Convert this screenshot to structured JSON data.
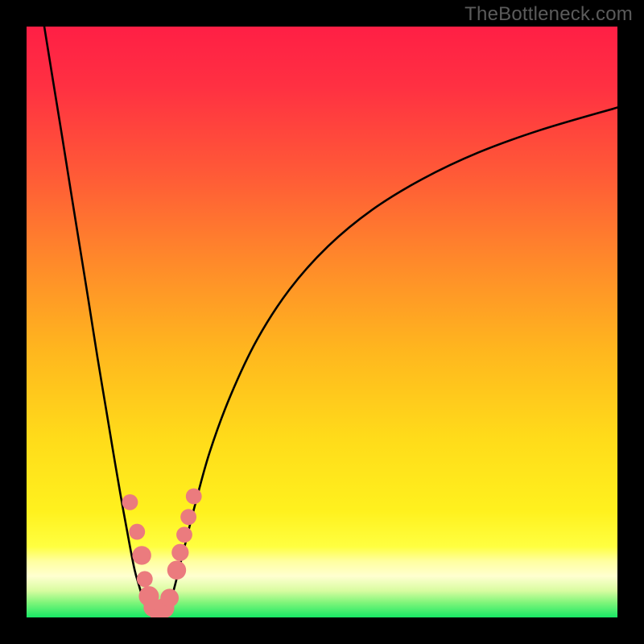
{
  "watermark": "TheBottleneck.com",
  "gradient_stops": [
    {
      "offset": 0.0,
      "color": "#ff1f45"
    },
    {
      "offset": 0.1,
      "color": "#ff3042"
    },
    {
      "offset": 0.25,
      "color": "#ff5a37"
    },
    {
      "offset": 0.4,
      "color": "#ff8a2a"
    },
    {
      "offset": 0.55,
      "color": "#ffb71e"
    },
    {
      "offset": 0.7,
      "color": "#ffdc1a"
    },
    {
      "offset": 0.82,
      "color": "#fff11e"
    },
    {
      "offset": 0.88,
      "color": "#ffff40"
    },
    {
      "offset": 0.905,
      "color": "#ffffa0"
    },
    {
      "offset": 0.93,
      "color": "#ffffd0"
    },
    {
      "offset": 0.955,
      "color": "#d8fca0"
    },
    {
      "offset": 0.975,
      "color": "#7ff57a"
    },
    {
      "offset": 1.0,
      "color": "#18e865"
    }
  ],
  "chart_data": {
    "type": "line",
    "title": "",
    "xlabel": "",
    "ylabel": "",
    "xlim": [
      0,
      100
    ],
    "ylim": [
      0,
      100
    ],
    "series": [
      {
        "name": "left-branch",
        "x": [
          3.0,
          4.5,
          6.0,
          7.5,
          9.0,
          10.5,
          12.0,
          13.5,
          15.0,
          16.3,
          17.5,
          18.3,
          19.0,
          19.6,
          20.1,
          20.7
        ],
        "y": [
          100,
          90.7,
          81.5,
          72.1,
          62.8,
          53.5,
          44.0,
          35.0,
          26.0,
          18.5,
          12.0,
          8.0,
          5.5,
          3.5,
          2.0,
          1.0
        ]
      },
      {
        "name": "valley-floor",
        "x": [
          20.7,
          21.2,
          21.8,
          22.5,
          23.2,
          23.9
        ],
        "y": [
          1.0,
          0.5,
          0.5,
          0.6,
          0.8,
          1.2
        ]
      },
      {
        "name": "right-branch",
        "x": [
          23.9,
          25.0,
          26.5,
          28.5,
          31.0,
          34.5,
          39.0,
          44.5,
          51.0,
          58.5,
          67.0,
          76.5,
          87.0,
          100.0
        ],
        "y": [
          1.2,
          5.0,
          11.0,
          19.0,
          28.0,
          37.5,
          47.0,
          55.5,
          62.8,
          69.0,
          74.2,
          78.7,
          82.5,
          86.3
        ]
      }
    ],
    "markers": {
      "name": "highlighted-points",
      "color": "#eb7b7e",
      "points": [
        {
          "x": 17.5,
          "y": 19.5,
          "r": 1.35
        },
        {
          "x": 18.7,
          "y": 14.5,
          "r": 1.35
        },
        {
          "x": 19.5,
          "y": 10.5,
          "r": 1.6
        },
        {
          "x": 20.0,
          "y": 6.5,
          "r": 1.35
        },
        {
          "x": 20.7,
          "y": 3.6,
          "r": 1.7
        },
        {
          "x": 21.4,
          "y": 1.7,
          "r": 1.6
        },
        {
          "x": 22.4,
          "y": 1.0,
          "r": 1.7
        },
        {
          "x": 23.3,
          "y": 1.6,
          "r": 1.7
        },
        {
          "x": 24.2,
          "y": 3.3,
          "r": 1.55
        },
        {
          "x": 25.4,
          "y": 8.0,
          "r": 1.6
        },
        {
          "x": 26.0,
          "y": 11.0,
          "r": 1.45
        },
        {
          "x": 26.7,
          "y": 14.0,
          "r": 1.35
        },
        {
          "x": 27.4,
          "y": 17.0,
          "r": 1.35
        },
        {
          "x": 28.3,
          "y": 20.5,
          "r": 1.35
        }
      ]
    }
  }
}
